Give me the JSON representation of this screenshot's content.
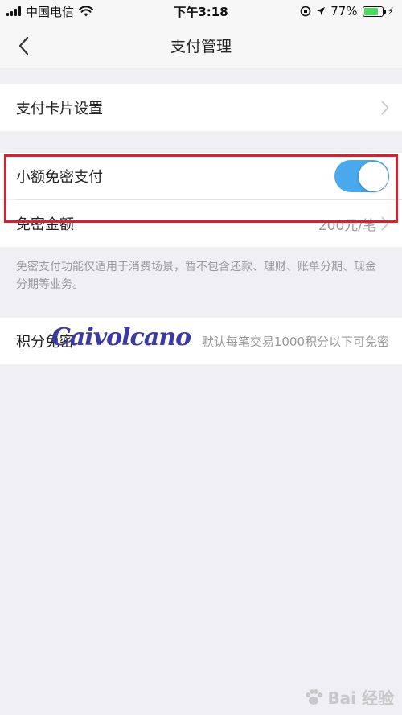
{
  "status_bar": {
    "carrier": "中国电信",
    "time": "下午3:18",
    "battery_percent": "77%",
    "battery_level": 0.77,
    "battery_color": "#4cd964"
  },
  "nav": {
    "title": "支付管理",
    "back_icon": "chevron-left-icon"
  },
  "sections": {
    "card_settings": {
      "label": "支付卡片设置"
    },
    "small_payment": {
      "label": "小额免密支付",
      "toggle_on": true,
      "toggle_color": "#4aa8ec"
    },
    "amount": {
      "label": "免密金额",
      "value": "200元/笔"
    },
    "note": "免密支付功能仅适用于消费场景，暂不包含还款、理财、账单分期、现金分期等业务。",
    "points": {
      "label": "积分免密",
      "description": "默认每笔交易1000积分以下可免密"
    }
  },
  "overlays": {
    "signature": "Caivolcano",
    "baidu_logo": "Bai 经验",
    "highlight_color": "#d32330"
  }
}
